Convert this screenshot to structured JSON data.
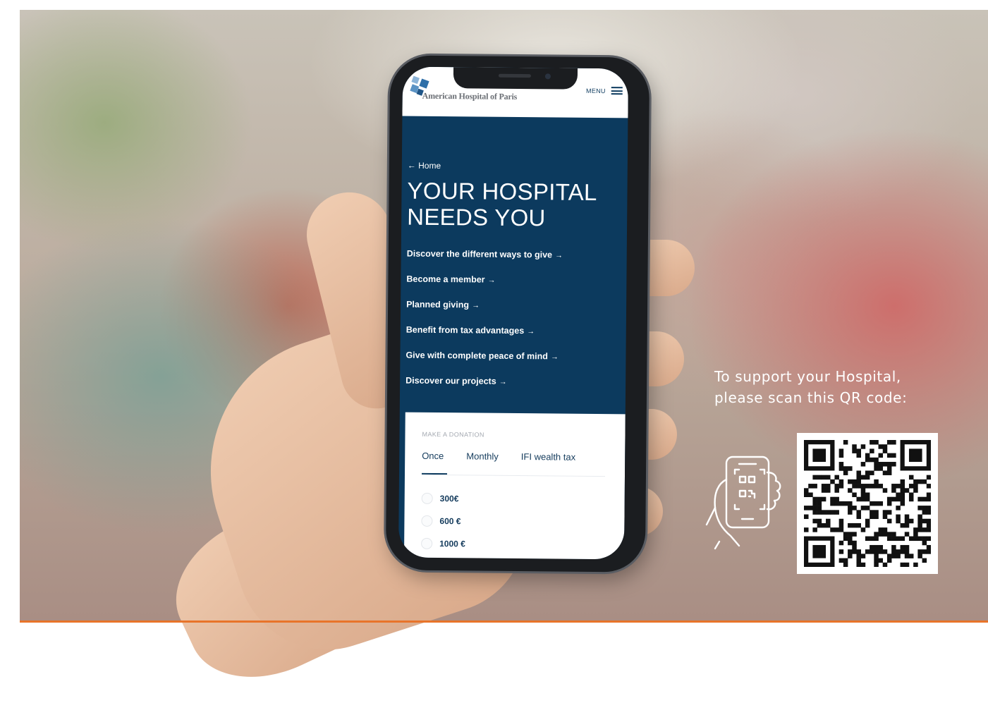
{
  "phone": {
    "brand_name": "American Hospital of Paris",
    "menu_label": "MENU",
    "back_link": "← Home",
    "hero_title_line1": "YOUR HOSPITAL",
    "hero_title_line2": "NEEDS YOU",
    "links": [
      "Discover the different ways to give",
      "Become a member",
      "Planned giving",
      "Benefit from tax advantages",
      "Give with complete peace of mind",
      "Discover our projects"
    ],
    "donation": {
      "label": "MAKE A DONATION",
      "tabs": [
        "Once",
        "Monthly",
        "IFI wealth tax"
      ],
      "active_tab": "Once",
      "amounts": [
        "300€",
        "600 €",
        "1000 €"
      ]
    }
  },
  "cta": {
    "line1": "To support your Hospital,",
    "line2": "please scan this QR code:"
  },
  "icons": [
    "hand-phone-scan-icon",
    "qr-code",
    "hamburger-menu-icon",
    "hospital-logo-icon"
  ],
  "colors": {
    "navy": "#0c3a5e",
    "accent_orange": "#e8742a",
    "white": "#ffffff"
  }
}
